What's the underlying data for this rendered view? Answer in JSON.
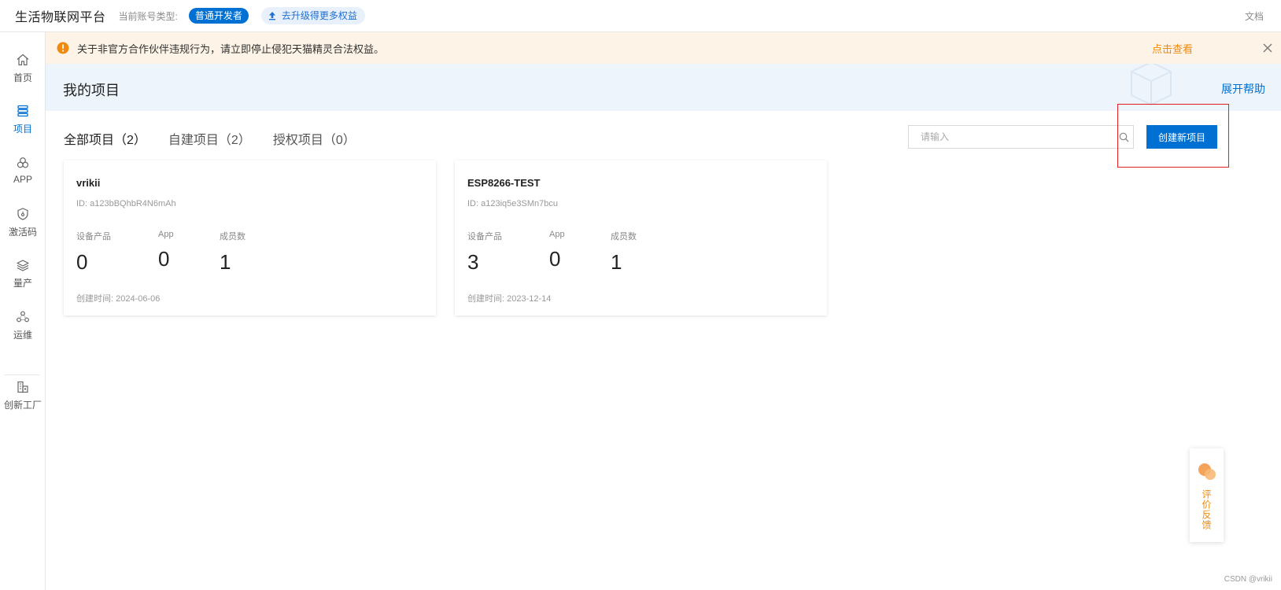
{
  "topbar": {
    "brand": "生活物联网平台",
    "account_label": "当前账号类型:",
    "account_type": "普通开发者",
    "upgrade": "去升级得更多权益",
    "docs": "文档"
  },
  "sidebar": {
    "items": [
      {
        "label": "首页",
        "icon": "home-icon"
      },
      {
        "label": "项目",
        "icon": "project-icon",
        "active": true
      },
      {
        "label": "APP",
        "icon": "app-icon"
      },
      {
        "label": "激活码",
        "icon": "activation-code-icon"
      },
      {
        "label": "量产",
        "icon": "mass-production-icon"
      },
      {
        "label": "运维",
        "icon": "operations-icon"
      },
      {
        "label": "创新工厂",
        "icon": "innovation-factory-icon"
      }
    ]
  },
  "notice": {
    "message": "关于非官方合作伙伴违规行为，请立即停止侵犯天猫精灵合法权益。",
    "link": "点击查看"
  },
  "header": {
    "title": "我的项目",
    "help": "展开帮助"
  },
  "tabs": [
    {
      "label": "全部项目（2）",
      "active": true
    },
    {
      "label": "自建项目（2）"
    },
    {
      "label": "授权项目（0）"
    }
  ],
  "search": {
    "placeholder": "请输入",
    "value": ""
  },
  "create_button": "创建新项目",
  "projects": [
    {
      "name": "vrikii",
      "id": "ID: a123bBQhbR4N6mAh",
      "stats": [
        {
          "label": "设备产品",
          "value": "0"
        },
        {
          "label": "App",
          "value": "0"
        },
        {
          "label": "成员数",
          "value": "1"
        }
      ],
      "created": "创建时间: 2024-06-06"
    },
    {
      "name": "ESP8266-TEST",
      "id": "ID: a123iq5e3SMn7bcu",
      "stats": [
        {
          "label": "设备产品",
          "value": "3"
        },
        {
          "label": "App",
          "value": "0"
        },
        {
          "label": "成员数",
          "value": "1"
        }
      ],
      "created": "创建时间: 2023-12-14"
    }
  ],
  "feedback": "评价反馈",
  "watermark": "CSDN @vrikii",
  "colors": {
    "primary": "#0070d2",
    "notice_bg": "#fdf3e6",
    "notice_link": "#f08a0f",
    "highlight_box": "#e02020"
  }
}
